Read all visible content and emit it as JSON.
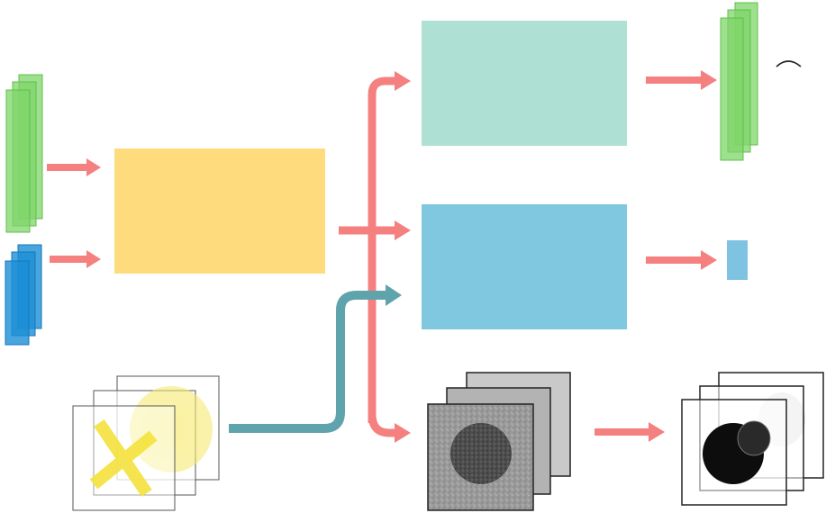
{
  "diagram": {
    "inputs": {
      "green_stack": {
        "layers": 3,
        "color": "#7fd66a"
      },
      "blue_stack": {
        "layers": 3,
        "color": "#1c8fd6"
      },
      "image_stack": {
        "layers": 3,
        "marker_color": "#f5e23c"
      }
    },
    "blocks": {
      "encoder": {
        "color": "#fedc7d"
      },
      "upper_head": {
        "color": "#aee0d4"
      },
      "middle_head": {
        "color": "#80c8df"
      }
    },
    "outputs": {
      "green_stack": {
        "layers": 3,
        "color": "#7fd66a"
      },
      "blue_bar": {
        "color": "#7fc3e3"
      },
      "gray_image_stack": {
        "layers": 3
      },
      "mask_stack": {
        "layers": 3
      }
    },
    "colors": {
      "arrow_main": "#f58080",
      "arrow_secondary": "#5fa3ad"
    }
  }
}
